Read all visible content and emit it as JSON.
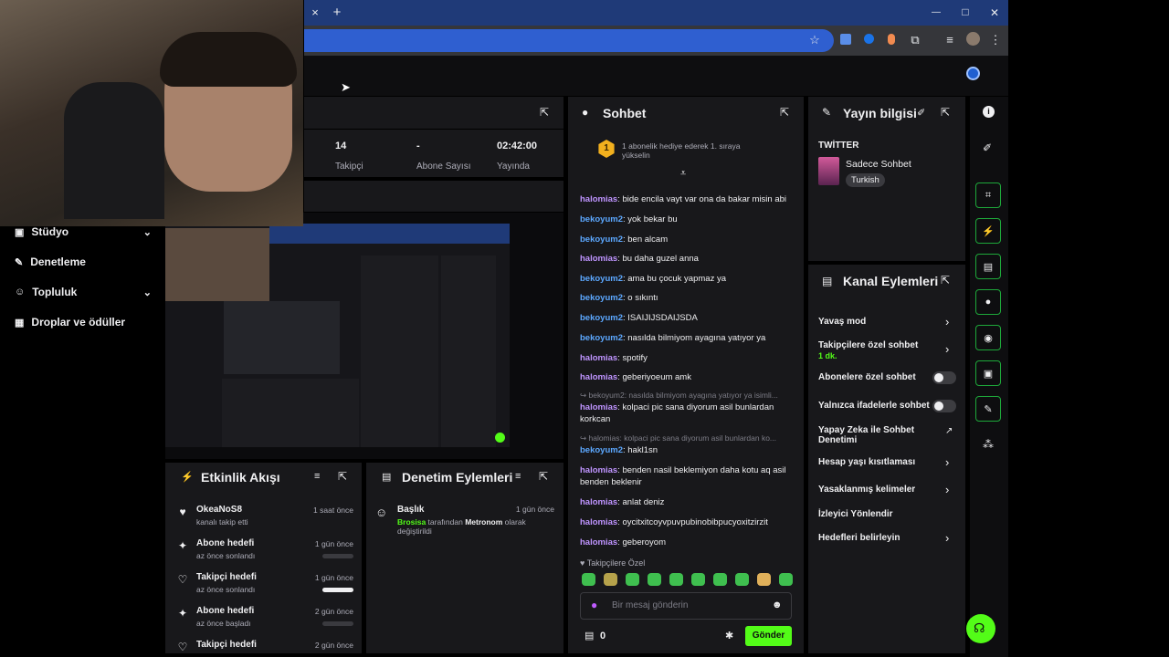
{
  "browser": {
    "tab_close": "×",
    "new_tab": "+",
    "win_min": "—",
    "win_max": "□",
    "win_close": "✕"
  },
  "sidebar": {
    "items": [
      {
        "label": "Stüdyo",
        "icon": "studio-icon",
        "chevron": "⌄"
      },
      {
        "label": "Denetleme",
        "icon": "wrench-icon"
      },
      {
        "label": "Topluluk",
        "icon": "community-icon",
        "chevron": "⌄"
      },
      {
        "label": "Droplar ve ödüller",
        "icon": "drops-icon"
      }
    ]
  },
  "stats": [
    {
      "value": "14",
      "label": "Takipçi"
    },
    {
      "value": "-",
      "label": "Abone Sayısı"
    },
    {
      "value": "02:42:00",
      "label": "Yayında"
    }
  ],
  "chat": {
    "title": "Sohbet",
    "pinned": "1 abonelik hediye ederek 1. sıraya yükselin",
    "pinned_rank": "1",
    "messages": [
      {
        "user": "halomias",
        "color": "#bf94ff",
        "text": "bide encila vayt var ona da bakar misin abi"
      },
      {
        "user": "bekoyum2",
        "color": "#5ca8ff",
        "text": "yok bekar bu"
      },
      {
        "user": "bekoyum2",
        "color": "#5ca8ff",
        "text": "ben alcam"
      },
      {
        "user": "halomias",
        "color": "#bf94ff",
        "text": "bu daha guzel anna"
      },
      {
        "user": "bekoyum2",
        "color": "#5ca8ff",
        "text": "ama bu çocuk yapmaz ya"
      },
      {
        "user": "bekoyum2",
        "color": "#5ca8ff",
        "text": "o sıkıntı"
      },
      {
        "user": "bekoyum2",
        "color": "#5ca8ff",
        "text": "ISAIJIJSDAIJSDA"
      },
      {
        "user": "bekoyum2",
        "color": "#5ca8ff",
        "text": "nasılda bilmiyom ayagına yatıyor ya"
      },
      {
        "user": "halomias",
        "color": "#bf94ff",
        "text": "spotify"
      },
      {
        "user": "halomias",
        "color": "#bf94ff",
        "text": "geberiyoeum amk"
      }
    ],
    "reply1": "↪ bekoyum2: nasılda bilmiyom ayagına yatıyor ya isimli...",
    "msg_after_reply1": {
      "user": "halomias",
      "color": "#bf94ff",
      "text": "kolpaci pic sana diyorum asil bunlardan korkcan"
    },
    "reply2": "↪ halomias: kolpaci pic sana diyorum asil bunlardan ko...",
    "messages2": [
      {
        "user": "bekoyum2",
        "color": "#5ca8ff",
        "text": "hakl1sn"
      },
      {
        "user": "halomias",
        "color": "#bf94ff",
        "text": "benden nasil beklemiyon daha kotu aq asil benden beklenir"
      },
      {
        "user": "halomias",
        "color": "#bf94ff",
        "text": "anlat deniz"
      },
      {
        "user": "halomias",
        "color": "#bf94ff",
        "text": "oycitxitcoyvpuvpubinobibpucyoxitzirzit"
      },
      {
        "user": "halomias",
        "color": "#bf94ff",
        "text": "geberoyom"
      }
    ],
    "followers_only": "Takipçilere Özel",
    "input_placeholder": "Bir mesaj gönderin",
    "points": "0",
    "send": "Gönder"
  },
  "stream_info": {
    "title": "Yayın bilgisi",
    "platform": "TWİTTER",
    "stream_title": "Sadece Sohbet",
    "tag": "Turkish"
  },
  "channel_actions": {
    "title": "Kanal Eylemleri",
    "rows": [
      {
        "label": "Yavaş mod",
        "kind": "arrow"
      },
      {
        "label": "Takipçilere özel sohbet",
        "sub": "1 dk.",
        "kind": "arrow"
      },
      {
        "label": "Abonelere özel sohbet",
        "kind": "toggle"
      },
      {
        "label": "Yalnızca ifadelerle sohbet",
        "kind": "toggle"
      },
      {
        "label": "Yapay Zeka ile Sohbet Denetimi",
        "kind": "ext"
      },
      {
        "label": "Hesap yaşı kısıtlaması",
        "kind": "arrow"
      },
      {
        "label": "Yasaklanmış kelimeler",
        "kind": "arrow"
      },
      {
        "label": "İzleyici Yönlendir",
        "kind": "none"
      },
      {
        "label": "Hedefleri belirleyin",
        "kind": "arrow"
      }
    ]
  },
  "activity": {
    "title": "Etkinlik Akışı",
    "items": [
      {
        "name": "OkeaNoS8",
        "sub": "kanalı takip etti",
        "time": "1 saat önce",
        "icon": "heart-icon"
      },
      {
        "name": "Abone hedefi",
        "sub": "az önce sonlandı",
        "time": "1 gün önce",
        "icon": "sparkle-icon"
      },
      {
        "name": "Takipçi hedefi",
        "sub": "az önce sonlandı",
        "time": "1 gün önce",
        "icon": "heart-outline-icon"
      },
      {
        "name": "Abone hedefi",
        "sub": "az önce başladı",
        "time": "2 gün önce",
        "icon": "sparkle-icon"
      },
      {
        "name": "Takipçi hedefi",
        "sub": "",
        "time": "2 gün önce",
        "icon": "heart-outline-icon"
      }
    ]
  },
  "moderation": {
    "title": "Denetim Eylemleri",
    "item": {
      "title": "Başlık",
      "time": "1 gün önce",
      "actor": "Brosisa",
      "middle": " tarafından ",
      "target": "Metronom",
      "suffix": " olarak değiştirildi"
    }
  },
  "colors": {
    "accent": "#53fc18",
    "panel": "#18181b",
    "bg": "#0e0e10"
  }
}
